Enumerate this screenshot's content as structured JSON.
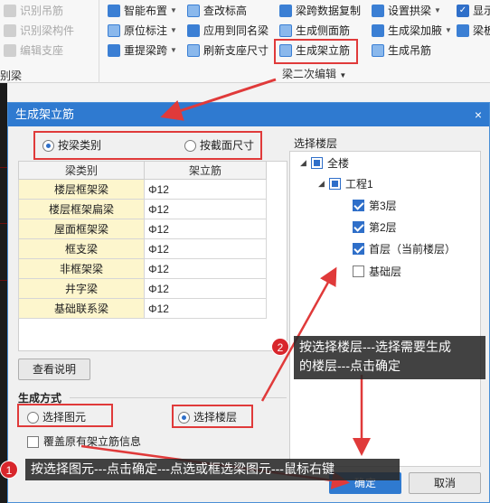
{
  "ribbon": {
    "left_items": [
      {
        "label": "识别吊筋",
        "icon": "identify-hanger-icon"
      },
      {
        "label": "识别梁构件",
        "icon": "identify-beam-icon"
      },
      {
        "label": "编辑支座",
        "icon": "edit-support-icon"
      }
    ],
    "left_bottom_label": "别梁",
    "col1": [
      {
        "label": "智能布置",
        "icon": "smart-layout-icon"
      },
      {
        "label": "原位标注",
        "icon": "in-situ-annotation-icon"
      },
      {
        "label": "重提梁跨",
        "icon": "re-extract-span-icon"
      }
    ],
    "col2": [
      {
        "label": "查改标高",
        "icon": "check-elevation-icon"
      },
      {
        "label": "应用到同名梁",
        "icon": "apply-same-name-icon"
      },
      {
        "label": "刷新支座尺寸",
        "icon": "refresh-support-icon"
      }
    ],
    "col3": [
      {
        "label": "梁跨数据复制",
        "icon": "copy-span-data-icon"
      },
      {
        "label": "生成侧面筋",
        "icon": "side-rebar-icon"
      },
      {
        "label": "生成架立筋",
        "icon": "erection-rebar-icon"
      }
    ],
    "col4": [
      {
        "label": "设置拱梁",
        "icon": "arch-beam-icon"
      },
      {
        "label": "生成梁加腋",
        "icon": "beam-haunch-icon"
      },
      {
        "label": "生成吊筋",
        "icon": "hanger-rebar-icon"
      }
    ],
    "col5": [
      {
        "label": "显示",
        "icon": "show-checkbox-icon"
      },
      {
        "label": "梁板",
        "icon": "beam-slab-icon"
      }
    ],
    "group_label": "梁二次编辑"
  },
  "dialog": {
    "title": "生成架立筋",
    "close_glyph": "×",
    "mode": {
      "by_type": "按梁类别",
      "by_section": "按截面尺寸",
      "selected": "by_type"
    },
    "table": {
      "headers": [
        "梁类别",
        "架立筋"
      ],
      "rows": [
        {
          "type": "楼层框架梁",
          "rebar": "Φ12"
        },
        {
          "type": "楼层框架扁梁",
          "rebar": "Φ12"
        },
        {
          "type": "屋面框架梁",
          "rebar": "Φ12"
        },
        {
          "type": "框支梁",
          "rebar": "Φ12"
        },
        {
          "type": "非框架梁",
          "rebar": "Φ12"
        },
        {
          "type": "井字梁",
          "rebar": "Φ12"
        },
        {
          "type": "基础联系梁",
          "rebar": "Φ12"
        }
      ]
    },
    "help_button": "查看说明",
    "gen_method_label": "生成方式",
    "gen": {
      "by_element": "选择图元",
      "by_floor": "选择楼层",
      "selected": "by_floor"
    },
    "overwrite_label": "覆盖原有架立筋信息",
    "floor_label": "选择楼层",
    "tree": {
      "root": "全楼",
      "project": "工程1",
      "floors": [
        {
          "label": "第3层",
          "checked": true
        },
        {
          "label": "第2层",
          "checked": true
        },
        {
          "label": "首层（当前楼层）",
          "checked": true
        },
        {
          "label": "基础层",
          "checked": false
        }
      ]
    },
    "ok_button": "确定",
    "cancel_button": "取消"
  },
  "callouts": {
    "c1_num": "1",
    "c1_text": "按选择图元---点击确定---点选或框选梁图元---鼠标右键",
    "c2_num": "2",
    "c2_text_line1": "按选择楼层---选择需要生成",
    "c2_text_line2": "的楼层---点击确定"
  },
  "colors": {
    "highlight": "#e03a3a",
    "title_bar": "#2f7ad0",
    "callout_bg": "#282828"
  }
}
